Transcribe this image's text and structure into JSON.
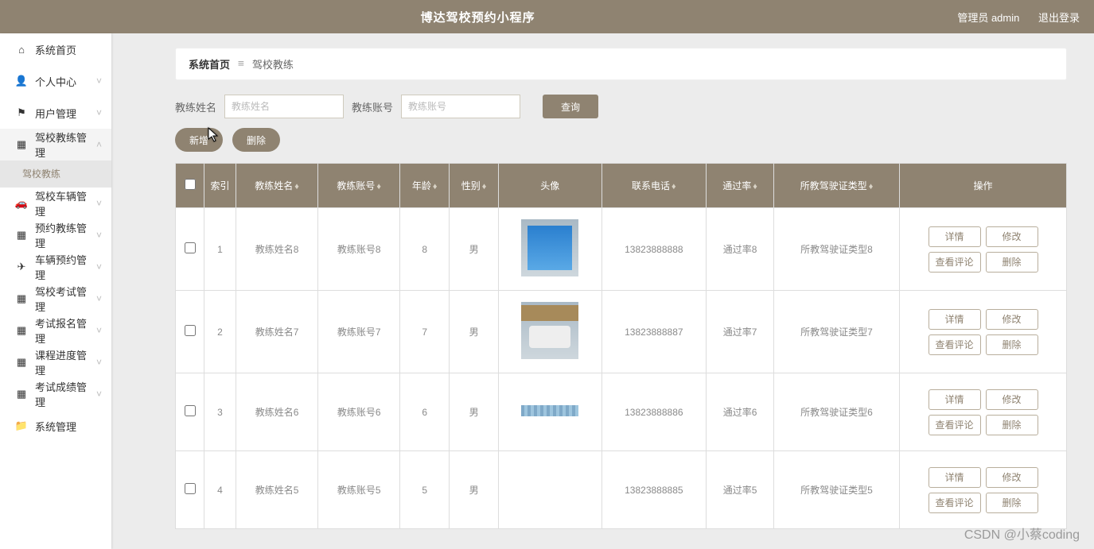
{
  "header": {
    "title": "博达驾校预约小程序",
    "user_label": "管理员 admin",
    "logout": "退出登录"
  },
  "sidebar": {
    "items": [
      {
        "icon": "⌂",
        "label": "系统首页",
        "arrow": ""
      },
      {
        "icon": "👤",
        "label": "个人中心",
        "arrow": "˅"
      },
      {
        "icon": "⚑",
        "label": "用户管理",
        "arrow": "˅"
      },
      {
        "icon": "▦",
        "label": "驾校教练管理",
        "arrow": "˄"
      },
      {
        "icon": "🚗",
        "label": "驾校车辆管理",
        "arrow": "˅"
      },
      {
        "icon": "▦",
        "label": "预约教练管理",
        "arrow": "˅"
      },
      {
        "icon": "✈",
        "label": "车辆预约管理",
        "arrow": "˅"
      },
      {
        "icon": "▦",
        "label": "驾校考试管理",
        "arrow": "˅"
      },
      {
        "icon": "▦",
        "label": "考试报名管理",
        "arrow": "˅"
      },
      {
        "icon": "▦",
        "label": "课程进度管理",
        "arrow": "˅"
      },
      {
        "icon": "▦",
        "label": "考试成绩管理",
        "arrow": "˅"
      },
      {
        "icon": "📁",
        "label": "系统管理",
        "arrow": ""
      }
    ],
    "sub_after_index": 3,
    "sub_label": "驾校教练"
  },
  "breadcrumb": {
    "sys": "系统首页",
    "sep": "≡",
    "page": "驾校教练"
  },
  "filters": {
    "name_label": "教练姓名",
    "name_placeholder": "教练姓名",
    "account_label": "教练账号",
    "account_placeholder": "教练账号",
    "query_btn": "查询"
  },
  "actions": {
    "add": "新增",
    "del": "删除"
  },
  "table": {
    "headers": {
      "checkbox": "",
      "index": "索引",
      "name": "教练姓名",
      "account": "教练账号",
      "age": "年龄",
      "gender": "性别",
      "avatar": "头像",
      "phone": "联系电话",
      "pass": "通过率",
      "teach_type": "所教驾驶证类型",
      "ops": "操作"
    },
    "op_buttons": {
      "detail": "详情",
      "edit": "修改",
      "comments": "查看评论",
      "delete": "删除"
    },
    "rows": [
      {
        "index": "1",
        "name": "教练姓名8",
        "account": "教练账号8",
        "age": "8",
        "gender": "男",
        "avatar_style": "a",
        "phone": "13823888888",
        "pass": "通过率8",
        "teach": "所教驾驶证类型8"
      },
      {
        "index": "2",
        "name": "教练姓名7",
        "account": "教练账号7",
        "age": "7",
        "gender": "男",
        "avatar_style": "b",
        "phone": "13823888887",
        "pass": "通过率7",
        "teach": "所教驾驶证类型7"
      },
      {
        "index": "3",
        "name": "教练姓名6",
        "account": "教练账号6",
        "age": "6",
        "gender": "男",
        "avatar_style": "short",
        "phone": "13823888886",
        "pass": "通过率6",
        "teach": "所教驾驶证类型6"
      },
      {
        "index": "4",
        "name": "教练姓名5",
        "account": "教练账号5",
        "age": "5",
        "gender": "男",
        "avatar_style": "none",
        "phone": "13823888885",
        "pass": "通过率5",
        "teach": "所教驾驶证类型5"
      }
    ]
  },
  "watermark": "CSDN @小蔡coding"
}
